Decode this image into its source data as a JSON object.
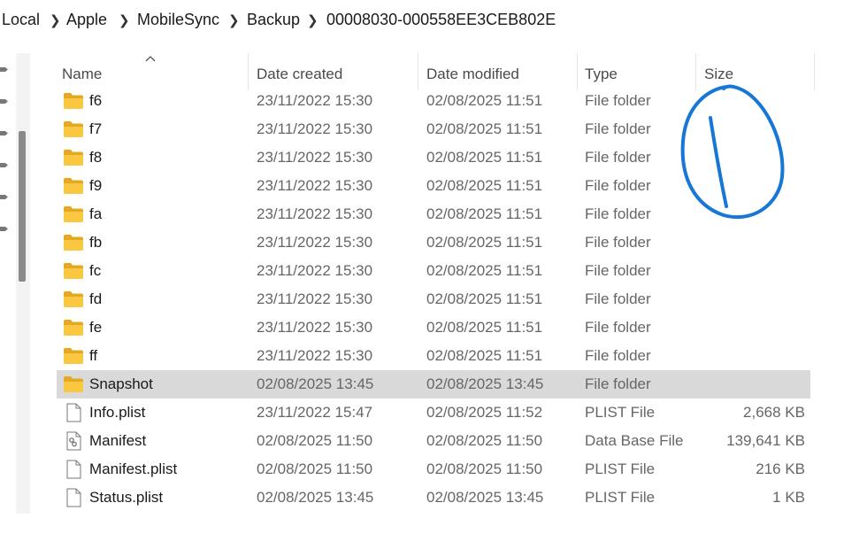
{
  "breadcrumb": [
    "Local",
    "Apple",
    "MobileSync",
    "Backup",
    "00008030-000558EE3CEB802E"
  ],
  "columns": {
    "name": "Name",
    "created": "Date created",
    "modified": "Date modified",
    "type": "Type",
    "size": "Size"
  },
  "rows": [
    {
      "name": "f6",
      "created": "23/11/2022 15:30",
      "modified": "02/08/2025 11:51",
      "type": "File folder",
      "size": "",
      "icon": "folder-icon"
    },
    {
      "name": "f7",
      "created": "23/11/2022 15:30",
      "modified": "02/08/2025 11:51",
      "type": "File folder",
      "size": "",
      "icon": "folder-icon"
    },
    {
      "name": "f8",
      "created": "23/11/2022 15:30",
      "modified": "02/08/2025 11:51",
      "type": "File folder",
      "size": "",
      "icon": "folder-icon"
    },
    {
      "name": "f9",
      "created": "23/11/2022 15:30",
      "modified": "02/08/2025 11:51",
      "type": "File folder",
      "size": "",
      "icon": "folder-icon"
    },
    {
      "name": "fa",
      "created": "23/11/2022 15:30",
      "modified": "02/08/2025 11:51",
      "type": "File folder",
      "size": "",
      "icon": "folder-icon"
    },
    {
      "name": "fb",
      "created": "23/11/2022 15:30",
      "modified": "02/08/2025 11:51",
      "type": "File folder",
      "size": "",
      "icon": "folder-icon"
    },
    {
      "name": "fc",
      "created": "23/11/2022 15:30",
      "modified": "02/08/2025 11:51",
      "type": "File folder",
      "size": "",
      "icon": "folder-icon"
    },
    {
      "name": "fd",
      "created": "23/11/2022 15:30",
      "modified": "02/08/2025 11:51",
      "type": "File folder",
      "size": "",
      "icon": "folder-icon"
    },
    {
      "name": "fe",
      "created": "23/11/2022 15:30",
      "modified": "02/08/2025 11:51",
      "type": "File folder",
      "size": "",
      "icon": "folder-icon"
    },
    {
      "name": "ff",
      "created": "23/11/2022 15:30",
      "modified": "02/08/2025 11:51",
      "type": "File folder",
      "size": "",
      "icon": "folder-icon"
    },
    {
      "name": "Snapshot",
      "created": "02/08/2025 13:45",
      "modified": "02/08/2025 13:45",
      "type": "File folder",
      "size": "",
      "icon": "folder-icon",
      "selected": true
    },
    {
      "name": "Info.plist",
      "created": "23/11/2022 15:47",
      "modified": "02/08/2025 11:52",
      "type": "PLIST File",
      "size": "2,668 KB",
      "icon": "file-icon"
    },
    {
      "name": "Manifest",
      "created": "02/08/2025 11:50",
      "modified": "02/08/2025 11:50",
      "type": "Data Base File",
      "size": "139,641 KB",
      "icon": "database-file-icon"
    },
    {
      "name": "Manifest.plist",
      "created": "02/08/2025 11:50",
      "modified": "02/08/2025 11:50",
      "type": "PLIST File",
      "size": "216 KB",
      "icon": "file-icon"
    },
    {
      "name": "Status.plist",
      "created": "02/08/2025 13:45",
      "modified": "02/08/2025 13:45",
      "type": "PLIST File",
      "size": "1 KB",
      "icon": "file-icon"
    }
  ],
  "colors": {
    "folder": "#f8c843",
    "selection": "#d9d9d9",
    "annotation": "#1777d6"
  }
}
